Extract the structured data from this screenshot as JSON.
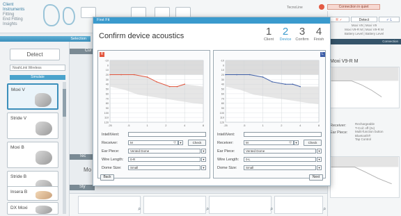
{
  "nav": {
    "items": [
      "Client",
      "Instruments",
      "Fitting",
      "End Fitting",
      "Insights"
    ]
  },
  "top": {
    "session_label": "TecnoLine",
    "connection_label": "Connection in quiet"
  },
  "sidebar": {
    "selection_label": "Selection",
    "detect_label": "Detect",
    "wireless_value": "NoahLink Wireless",
    "simulate_label": "Simulate",
    "devices": [
      {
        "name": "Moxi V",
        "selected": true
      },
      {
        "name": "Stride V"
      },
      {
        "name": "Moxi B"
      },
      {
        "name": "Stride B"
      },
      {
        "name": "Insera B"
      },
      {
        "name": "DX Moxi"
      }
    ]
  },
  "right_panel": {
    "tabs": [
      "R ✓",
      "Detect",
      "✓ L"
    ],
    "side_text": [
      "Moxi V9 | Moxi V9",
      "Moxi V9-R M | Moxi V9-R M",
      "Battery Level | Battery Level"
    ],
    "strip_label": "Connection",
    "device_name": "Moxi V9-R M",
    "labels": [
      "Receiver:",
      "Ear Piece:"
    ],
    "notes": [
      "Rechargeable",
      "T-Coil: off (2x)",
      "Multi-function button",
      "Bluetooth®",
      "Tap Control"
    ]
  },
  "underlay": {
    "title": "Confirm device acoustics",
    "bits": [
      "Cur",
      "Tec",
      "Mo",
      "Sty"
    ]
  },
  "dialog": {
    "window_title": "First Fit",
    "title": "Confirm device acoustics",
    "steps": [
      {
        "num": "1",
        "label": "Client"
      },
      {
        "num": "2",
        "label": "Device",
        "active": true
      },
      {
        "num": "3",
        "label": "Confirm"
      },
      {
        "num": "4",
        "label": "Finish"
      }
    ],
    "right_ear": {
      "badge": "R",
      "color": "#e2553d",
      "intellivent_label": "IntelliVent:",
      "receiver_label": "Receiver:",
      "receiver_value": "M",
      "check_label": "Check",
      "ear_piece_label": "Ear Piece:",
      "ear_piece_value": "Vented Dome",
      "wire_length_label": "Wire Length:",
      "wire_length_value": "0-R",
      "dome_size_label": "Dome Size:",
      "dome_size_value": "Small"
    },
    "left_ear": {
      "badge": "L",
      "color": "#3f5fa8",
      "intellivent_label": "IntelliVent:",
      "receiver_label": "Receiver:",
      "receiver_value": "M",
      "check_label": "Check",
      "ear_piece_label": "Ear Piece:",
      "ear_piece_value": "Vented Dome",
      "wire_length_label": "Wire Length:",
      "wire_length_value": "0-L",
      "dome_size_label": "Dome Size:",
      "dome_size_value": "Small"
    },
    "back_label": "Back",
    "next_label": "Next"
  },
  "chart": {
    "y_ticks": [
      "-10",
      "0",
      "10",
      "20",
      "30",
      "40",
      "50",
      "60",
      "70",
      "80",
      "90",
      "100",
      "110",
      "120"
    ],
    "x_ticks": [
      ".25",
      ".5",
      "1",
      "2",
      "4",
      "8"
    ],
    "right_curve": [
      [
        0,
        20
      ],
      [
        0.6,
        20
      ],
      [
        1.3,
        20
      ],
      [
        2.0,
        25
      ],
      [
        2.5,
        35
      ],
      [
        3.2,
        45
      ],
      [
        3.6,
        45
      ],
      [
        4.0,
        40
      ]
    ],
    "left_curve": [
      [
        0,
        20
      ],
      [
        0.6,
        20
      ],
      [
        1.3,
        20
      ],
      [
        2.0,
        25
      ],
      [
        2.5,
        35
      ],
      [
        3.2,
        40
      ],
      [
        3.6,
        40
      ],
      [
        4.0,
        45
      ]
    ]
  }
}
